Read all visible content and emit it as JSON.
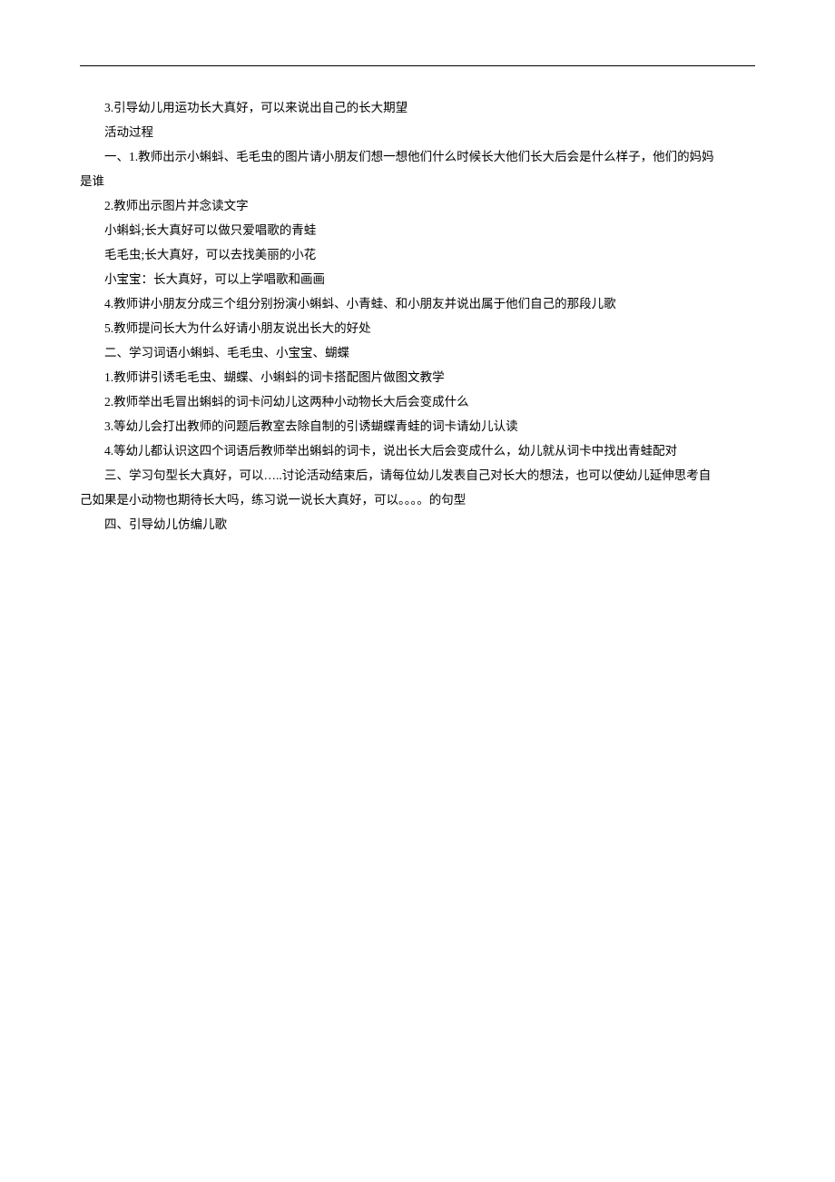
{
  "lines": [
    {
      "text": "3.引导幼儿用运功长大真好，可以来说出自己的长大期望",
      "indent": true
    },
    {
      "text": "活动过程",
      "indent": true
    },
    {
      "text": "一、1.教师出示小蝌蚪、毛毛虫的图片请小朋友们想一想他们什么时候长大他们长大后会是什么样子，他们的妈妈",
      "indent": true
    },
    {
      "text": "是谁",
      "indent": false
    },
    {
      "text": "2.教师出示图片并念读文字",
      "indent": true
    },
    {
      "text": "小蝌蚪;长大真好可以做只爱唱歌的青蛙",
      "indent": true
    },
    {
      "text": "毛毛虫;长大真好，可以去找美丽的小花",
      "indent": true
    },
    {
      "text": "小宝宝：长大真好，可以上学唱歌和画画",
      "indent": true
    },
    {
      "text": "4.教师讲小朋友分成三个组分别扮演小蝌蚪、小青蛙、和小朋友并说出属于他们自己的那段儿歌",
      "indent": true
    },
    {
      "text": "5.教师提问长大为什么好请小朋友说出长大的好处",
      "indent": true
    },
    {
      "text": "二、学习词语小蝌蚪、毛毛虫、小宝宝、蝴蝶",
      "indent": true
    },
    {
      "text": "1.教师讲引诱毛毛虫、蝴蝶、小蝌蚪的词卡搭配图片做图文教学",
      "indent": true
    },
    {
      "text": "2.教师举出毛冒出蝌蚪的词卡问幼儿这两种小动物长大后会变成什么",
      "indent": true
    },
    {
      "text": "3.等幼儿会打出教师的问题后教室去除自制的引诱蝴蝶青蛙的词卡请幼儿认读",
      "indent": true
    },
    {
      "text": "4.等幼儿都认识这四个词语后教师举出蝌蚪的词卡，说出长大后会变成什么，幼儿就从词卡中找出青蛙配对",
      "indent": true
    },
    {
      "text": "三、学习句型长大真好，可以…..讨论活动结束后，请每位幼儿发表自己对长大的想法，也可以使幼儿延伸思考自",
      "indent": true
    },
    {
      "text": "己如果是小动物也期待长大吗，练习说一说长大真好，可以。。。。的句型",
      "indent": false
    },
    {
      "text": "四、引导幼儿仿编儿歌",
      "indent": true
    }
  ]
}
